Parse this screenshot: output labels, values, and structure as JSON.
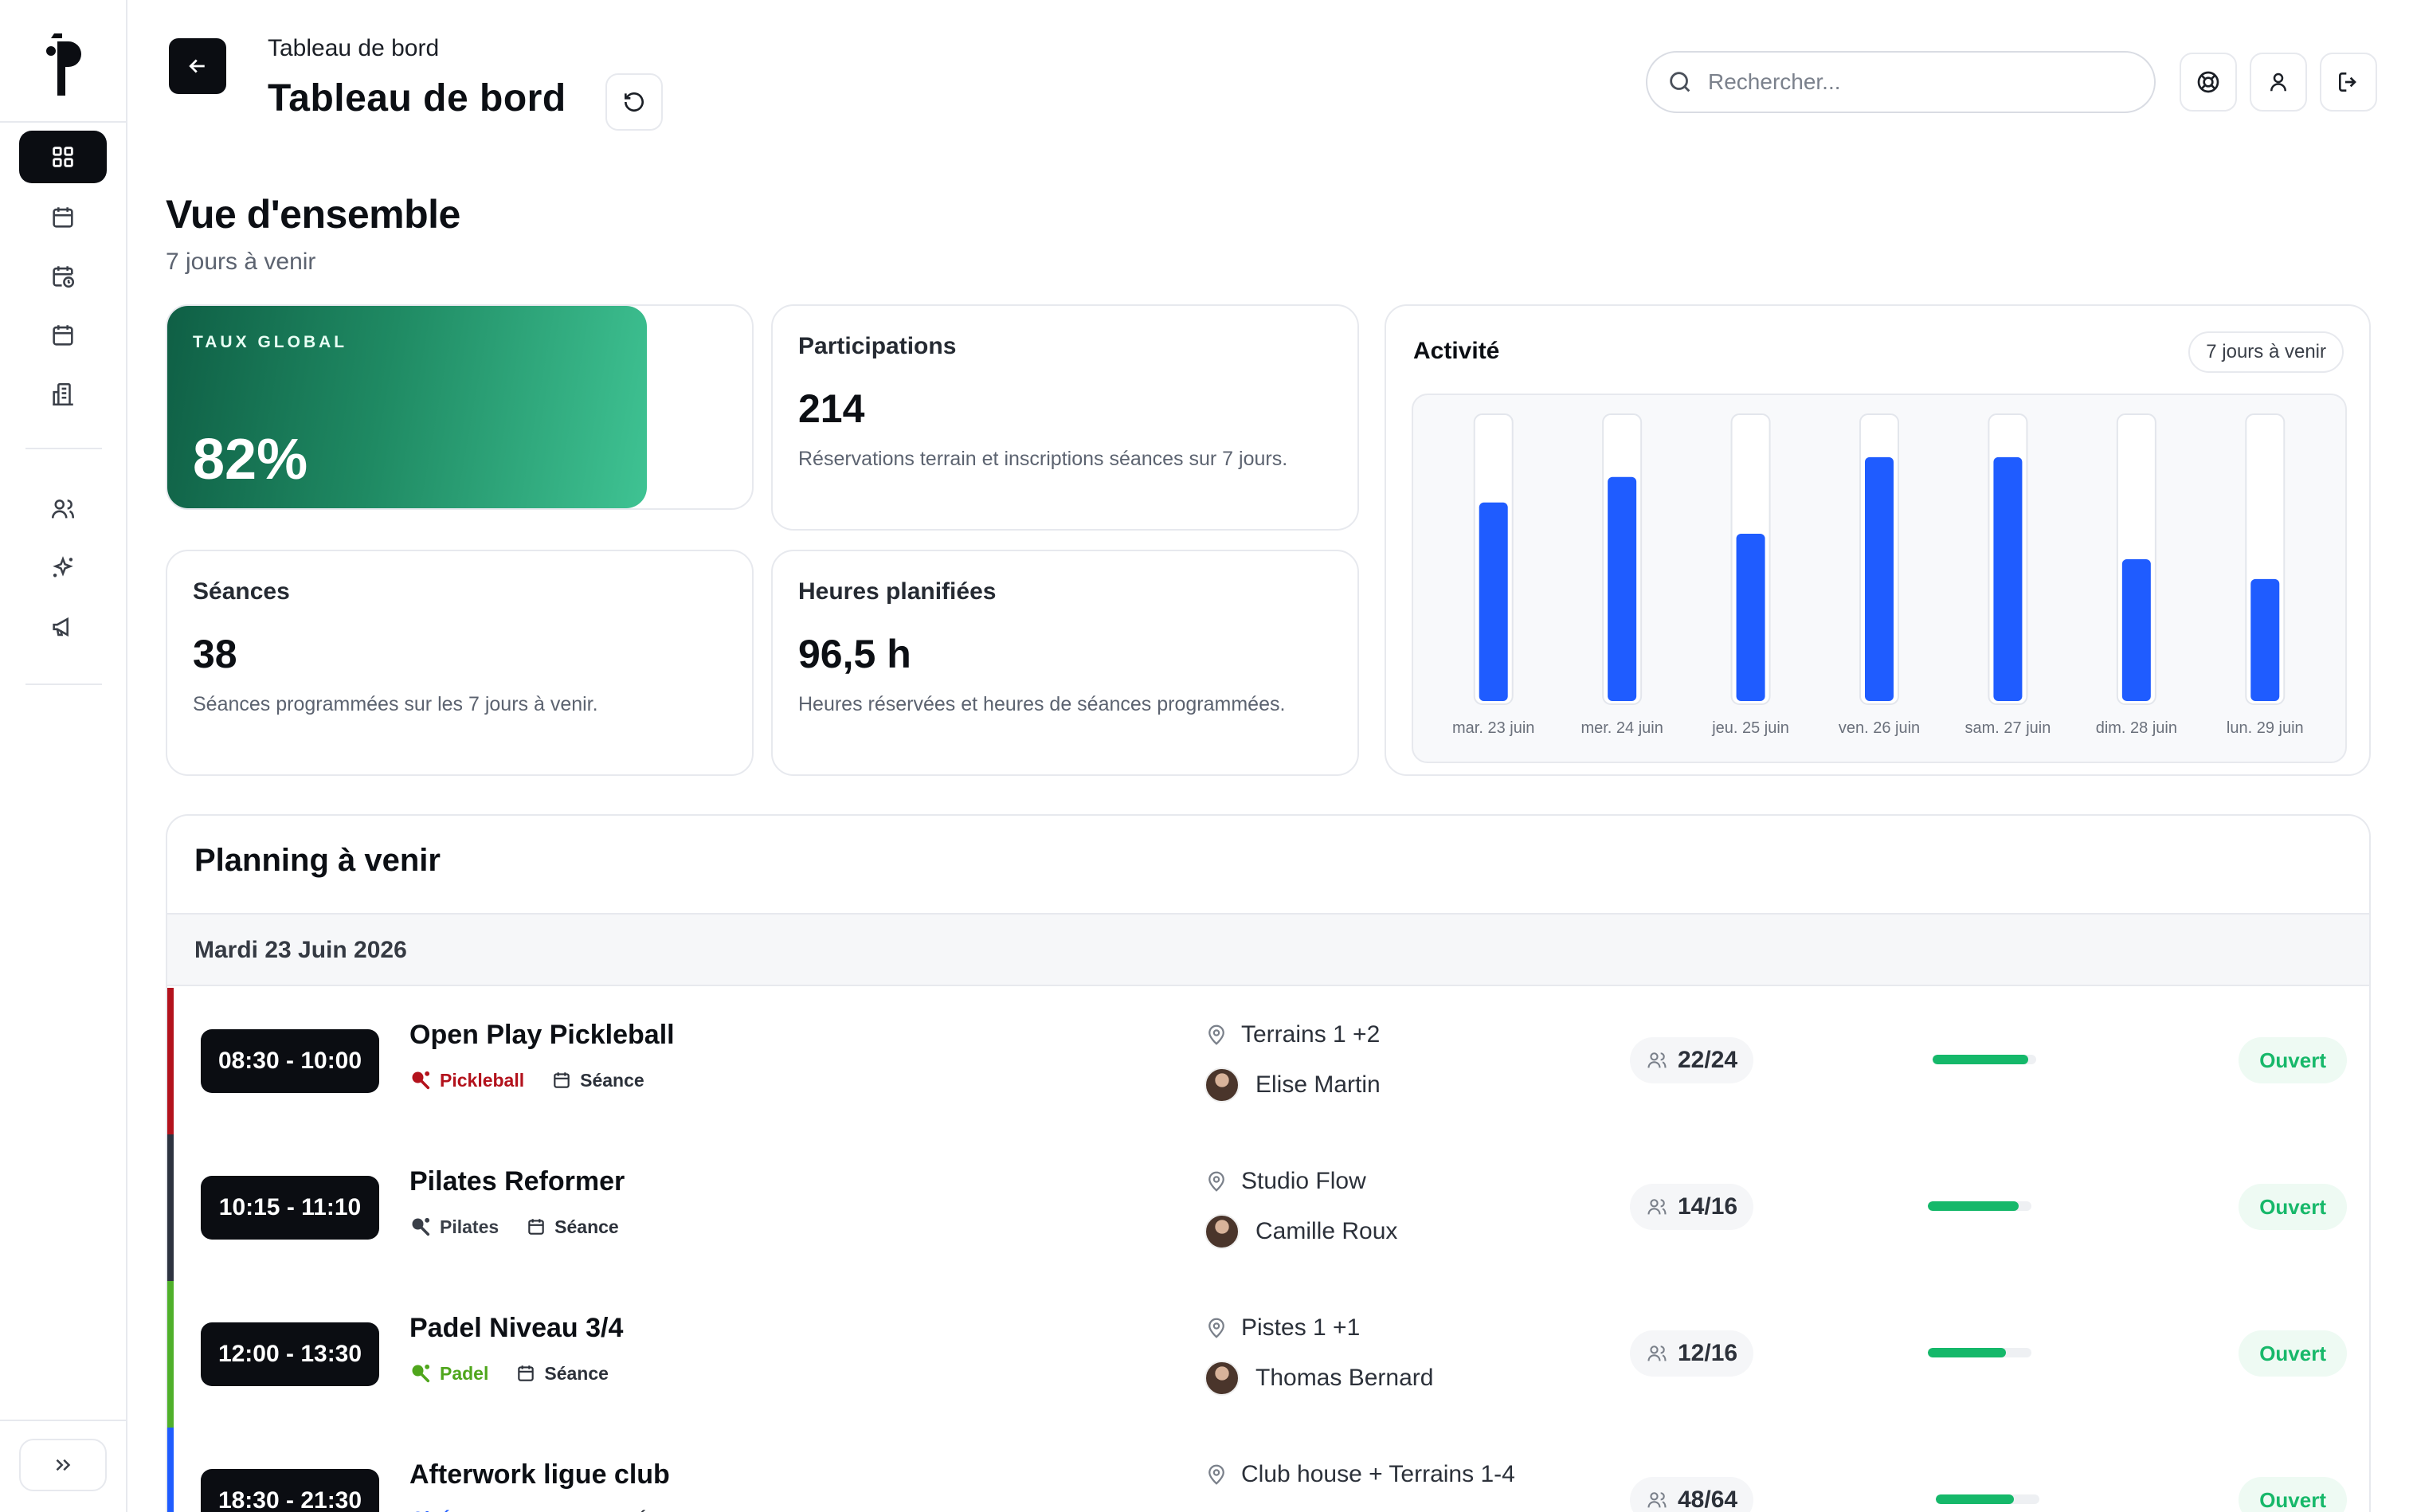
{
  "header": {
    "breadcrumb": "Tableau de bord",
    "title": "Tableau de bord",
    "search_placeholder": "Rechercher..."
  },
  "overview": {
    "title": "Vue d'ensemble",
    "subtitle": "7 jours à venir",
    "taux": {
      "label": "TAUX GLOBAL",
      "value": "82%",
      "fill": 0.82
    },
    "participations": {
      "label": "Participations",
      "value": "214",
      "desc": "Réservations terrain et inscriptions séances sur 7 jours."
    },
    "seances": {
      "label": "Séances",
      "value": "38",
      "desc": "Séances programmées sur les 7 jours à venir."
    },
    "heures": {
      "label": "Heures planifiées",
      "value": "96,5 h",
      "desc": "Heures réservées et heures de séances programmées."
    }
  },
  "activity": {
    "title": "Activité",
    "range_pill": "7 jours à venir"
  },
  "chart_data": {
    "type": "bar",
    "categories": [
      "mar. 23 juin",
      "mer. 24 juin",
      "jeu. 25 juin",
      "ven. 26 juin",
      "sam. 27 juin",
      "dim. 28 juin",
      "lun. 29 juin"
    ],
    "values": [
      70,
      79,
      59,
      86,
      86,
      50,
      43
    ],
    "ylim": [
      0,
      100
    ],
    "colors": {
      "bar": "#1f5cff",
      "track": "#ffffff"
    },
    "grid": false
  },
  "planning": {
    "title": "Planning à venir",
    "date": "Mardi 23 Juin 2026",
    "events": [
      {
        "time": "08:30 - 10:00",
        "title": "Open Play Pickleball",
        "sport": "Pickleball",
        "sport_color": "#b3121c",
        "type": "Séance",
        "location": "Terrains 1 +2",
        "coach": "Elise Martin",
        "capacity": "22/24",
        "fill": 0.92,
        "status": "Ouvert",
        "bar_color": "#b3121c"
      },
      {
        "time": "10:15 - 11:10",
        "title": "Pilates Reformer",
        "sport": "Pilates",
        "sport_color": "#3a3f48",
        "type": "Séance",
        "location": "Studio Flow",
        "coach": "Camille Roux",
        "capacity": "14/16",
        "fill": 0.88,
        "status": "Ouvert",
        "bar_color": "#2d3340"
      },
      {
        "time": "12:00 - 13:30",
        "title": "Padel Niveau 3/4",
        "sport": "Padel",
        "sport_color": "#4fa61c",
        "type": "Séance",
        "location": "Pistes 1 +1",
        "coach": "Thomas Bernard",
        "capacity": "12/16",
        "fill": 0.75,
        "status": "Ouvert",
        "bar_color": "#4fb02a"
      },
      {
        "time": "18:30 - 21:30",
        "title": "Afterwork ligue club",
        "sport": "Événement club",
        "sport_color": "#1f5cff",
        "type": "Événement",
        "location": "Club house + Terrains 1-4",
        "coach": "",
        "capacity": "48/64",
        "fill": 0.75,
        "status": "Ouvert",
        "bar_color": "#1f5cff"
      }
    ]
  }
}
